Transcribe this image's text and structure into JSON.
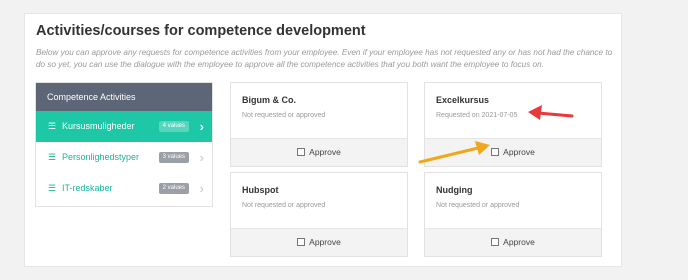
{
  "section": {
    "title": "Activities/courses for competence development",
    "description": "Below you can approve any requests for competence activities from your employee. Even if your employee has not requested any or has not had the chance to do so yet, you can use the dialogue with the employee to approve all the competence activities that you both want the employee to focus on."
  },
  "sidebar": {
    "header": "Competence Activities",
    "items": [
      {
        "label": "Kursusmuligheder",
        "badge": "4 values",
        "active": true
      },
      {
        "label": "Personlighedstyper",
        "badge": "3 values",
        "active": false
      },
      {
        "label": "IT-redskaber",
        "badge": "2 values",
        "active": false
      }
    ]
  },
  "cards": [
    {
      "title": "Bigum & Co.",
      "status": "Not requested or approved",
      "approve_label": "Approve"
    },
    {
      "title": "Excelkursus",
      "status": "Requested on 2021-07-05",
      "approve_label": "Approve"
    },
    {
      "title": "Hubspot",
      "status": "Not requested or approved",
      "approve_label": "Approve"
    },
    {
      "title": "Nudging",
      "status": "Not requested or approved",
      "approve_label": "Approve"
    }
  ],
  "icons": {
    "list": "list-icon",
    "chevron": "chevron-right-icon",
    "checkbox": "checkbox-icon"
  },
  "colors": {
    "accent": "#1ec8a7",
    "sidebar_header": "#5c6676",
    "annotation_red": "#e8393c",
    "annotation_orange": "#f0a81b"
  }
}
